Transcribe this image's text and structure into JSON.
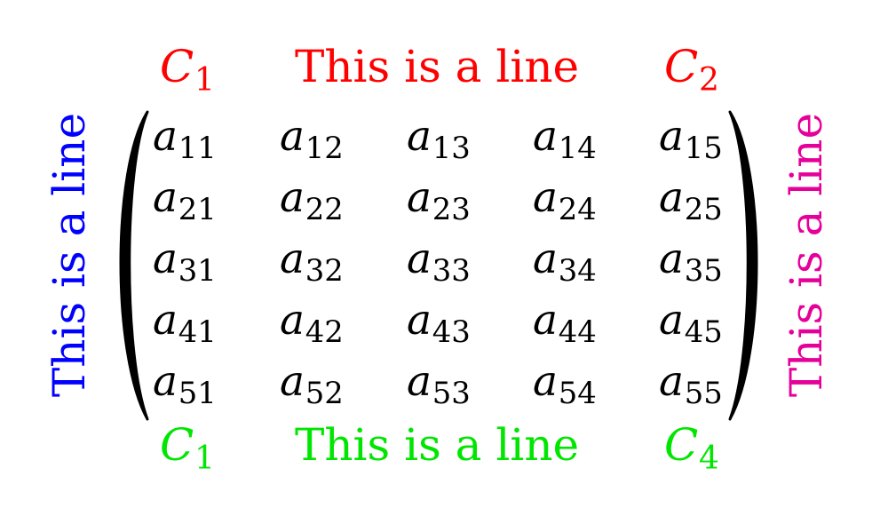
{
  "top": {
    "left": {
      "letter": "C",
      "sub": "1"
    },
    "middle": "This is a line",
    "right": {
      "letter": "C",
      "sub": "2"
    },
    "color": "#ff0000"
  },
  "bottom": {
    "left": {
      "letter": "C",
      "sub": "1"
    },
    "middle": "This is a line",
    "right": {
      "letter": "C",
      "sub": "4"
    },
    "color": "#00e600"
  },
  "left_side": {
    "text": "This is a line",
    "color": "#0000ff"
  },
  "right_side": {
    "text": "This is a line",
    "color": "#e6009a"
  },
  "matrix": {
    "symbol": "a",
    "rows": [
      [
        "11",
        "12",
        "13",
        "14",
        "15"
      ],
      [
        "21",
        "22",
        "23",
        "24",
        "25"
      ],
      [
        "31",
        "32",
        "33",
        "34",
        "35"
      ],
      [
        "41",
        "42",
        "43",
        "44",
        "45"
      ],
      [
        "51",
        "52",
        "53",
        "54",
        "55"
      ]
    ]
  }
}
